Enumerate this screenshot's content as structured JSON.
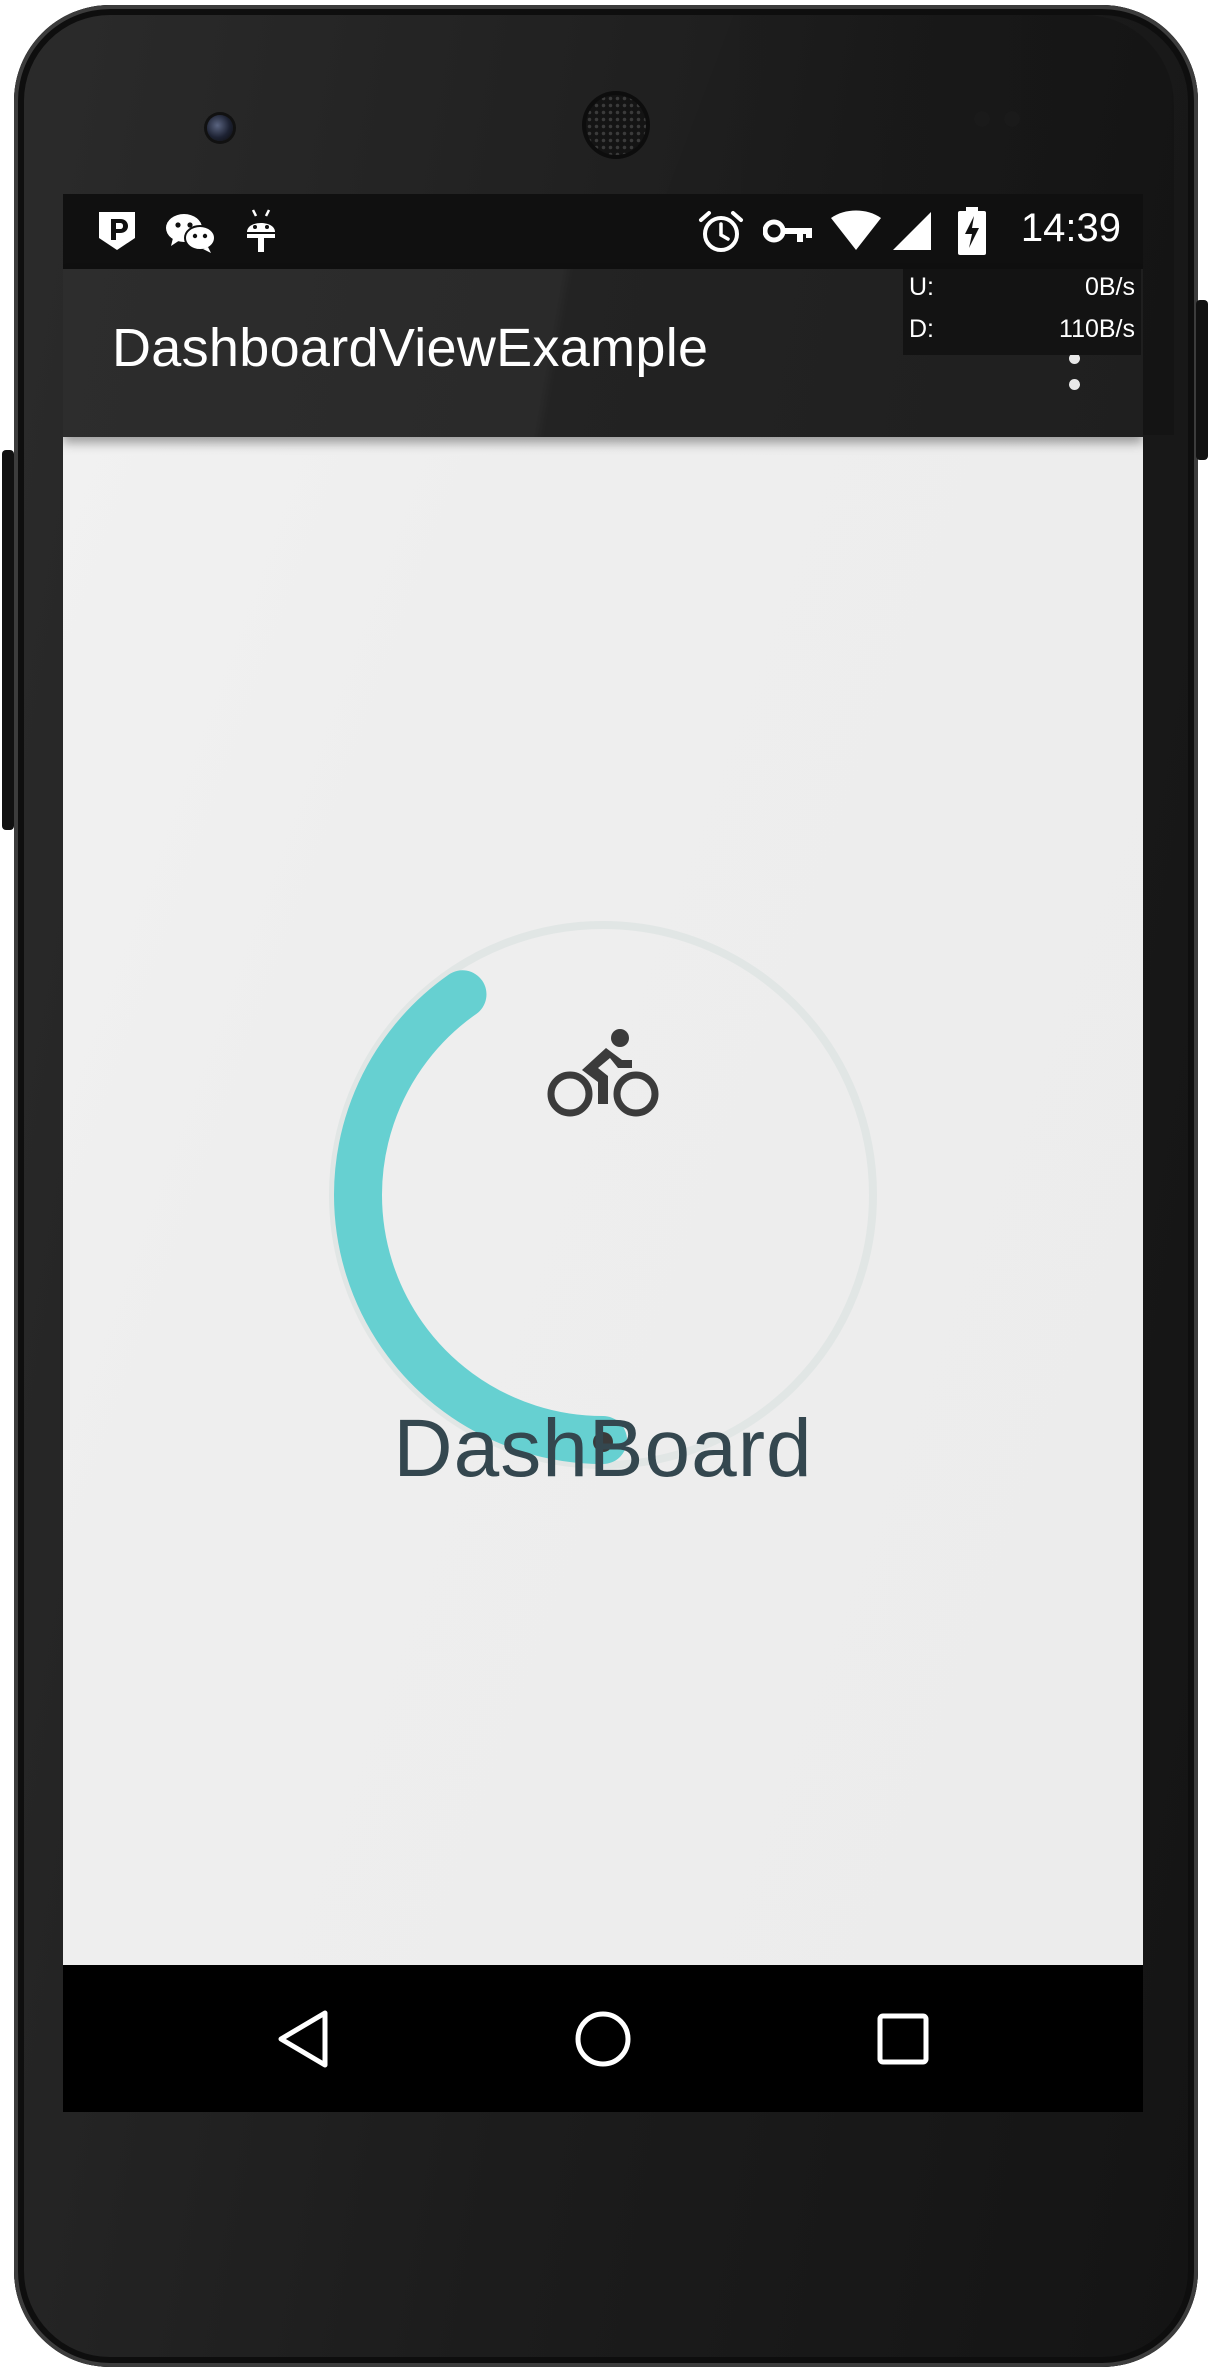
{
  "status_bar": {
    "time": "14:39",
    "left_icons": [
      "pocket-icon",
      "wechat-icon",
      "android-debug-icon"
    ],
    "right_icons": [
      "alarm-icon",
      "vpn-key-icon",
      "wifi-icon",
      "cell-signal-icon",
      "battery-charging-icon"
    ]
  },
  "network_overlay": {
    "upload_label": "U:",
    "upload_value": "0B/s",
    "download_label": "D:",
    "download_value": "110B/s"
  },
  "app_bar": {
    "title": "DashboardViewExample",
    "menu_icon": "more-vert-icon"
  },
  "dashboard": {
    "label": "DashBoard",
    "icon": "bike-icon",
    "progress_start_deg": -145,
    "progress_end_deg": 0,
    "colors": {
      "progress": "#66d0d1",
      "track": "#e1e6e5",
      "label": "#34474f",
      "icon": "#3b3b3b",
      "indicator": "#3a3a3a"
    }
  },
  "nav_bar": {
    "back_icon": "back-triangle-icon",
    "home_icon": "home-circle-icon",
    "recents_icon": "recents-square-icon"
  }
}
